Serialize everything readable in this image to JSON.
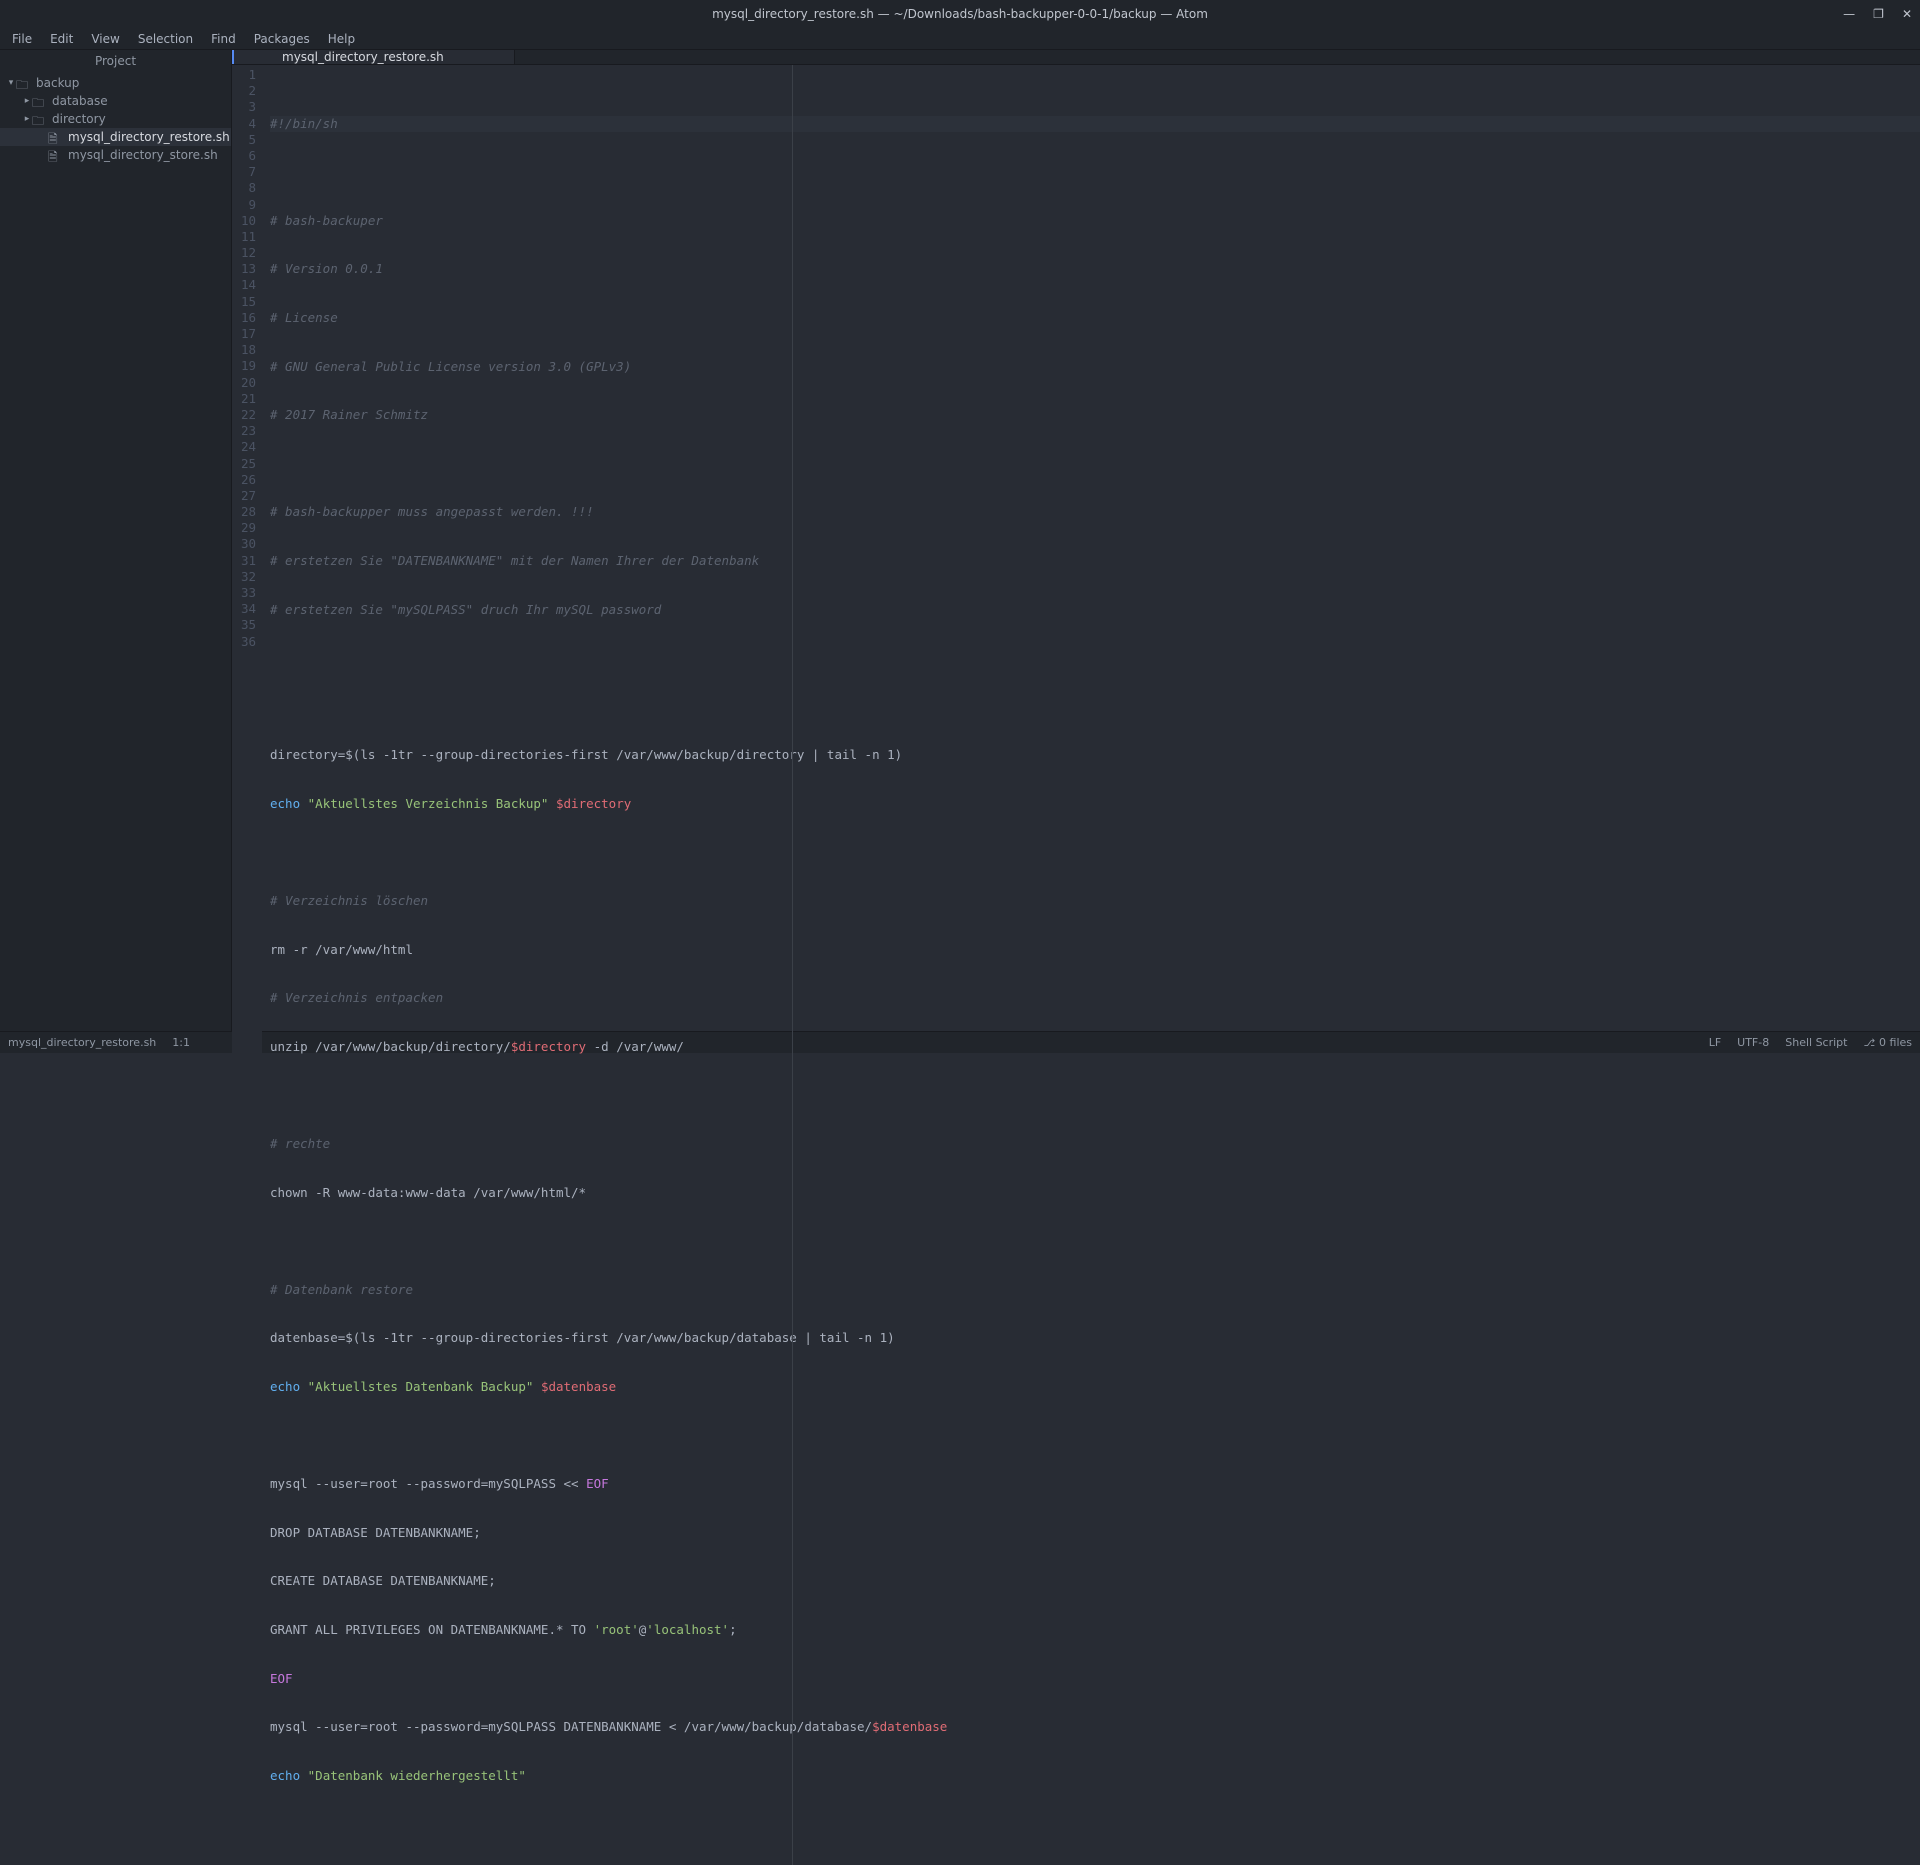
{
  "window": {
    "title": "mysql_directory_restore.sh — ~/Downloads/bash-backupper-0-0-1/backup — Atom"
  },
  "window_controls": {
    "minimize": "—",
    "maximize": "❐",
    "close": "✕"
  },
  "menu": {
    "file": "File",
    "edit": "Edit",
    "view": "View",
    "selection": "Selection",
    "find": "Find",
    "packages": "Packages",
    "help": "Help"
  },
  "sidebar": {
    "title": "Project",
    "tree": {
      "root": "backup",
      "folder_database": "database",
      "folder_directory": "directory",
      "file_restore": "mysql_directory_restore.sh",
      "file_store": "mysql_directory_store.sh"
    }
  },
  "tabs": {
    "t0": "mysql_directory_restore.sh"
  },
  "code": {
    "l1": "#!/bin/sh",
    "l2": "",
    "l3": "# bash-backuper",
    "l4": "# Version 0.0.1",
    "l5": "# License",
    "l6": "# GNU General Public License version 3.0 (GPLv3)",
    "l7": "# 2017 Rainer Schmitz",
    "l8": "",
    "l9": "# bash-backupper muss angepasst werden. !!!",
    "l10": "# erstetzen Sie \"DATENBANKNAME\" mit der Namen Ihrer der Datenbank",
    "l11": "# erstetzen Sie \"mySQLPASS\" druch Ihr mySQL password",
    "l12": "",
    "l13": "",
    "l14a": "directory=",
    "l14b": "$(",
    "l14c": "ls -1tr --group-directories-first /var/www/backup/directory ",
    "l14d": "|",
    "l14e": " tail -n 1)",
    "l15a": "echo",
    "l15b": " ",
    "l15c": "\"Aktuellstes Verzeichnis Backup\"",
    "l15d": " ",
    "l15e": "$directory",
    "l16": "",
    "l17": "# Verzeichnis löschen",
    "l18": "rm -r /var/www/html",
    "l19": "# Verzeichnis entpacken",
    "l20a": "unzip /var/www/backup/directory/",
    "l20b": "$directory",
    "l20c": " -d /var/www/",
    "l21": "",
    "l22": "# rechte",
    "l23": "chown -R www-data:www-data /var/www/html/*",
    "l24": "",
    "l25": "# Datenbank restore",
    "l26a": "datenbase=",
    "l26b": "$(",
    "l26c": "ls -1tr --group-directories-first /var/www/backup/database ",
    "l26d": "|",
    "l26e": " tail -n 1)",
    "l27a": "echo",
    "l27b": " ",
    "l27c": "\"Aktuellstes Datenbank Backup\"",
    "l27d": " ",
    "l27e": "$datenbase",
    "l28": "",
    "l29a": "mysql --user=root --password=mySQLPASS ",
    "l29b": "<<",
    "l29c": " ",
    "l29d": "EOF",
    "l30": "DROP DATABASE DATENBANKNAME;",
    "l31": "CREATE DATABASE DATENBANKNAME;",
    "l32a": "GRANT ALL PRIVILEGES ON DATENBANKNAME.* TO ",
    "l32b": "'root'",
    "l32c": "@",
    "l32d": "'localhost'",
    "l32e": ";",
    "l33": "EOF",
    "l34a": "mysql --user=root --password=mySQLPASS DATENBANKNAME ",
    "l34b": "<",
    "l34c": " /var/www/backup/database/",
    "l34d": "$datenbase",
    "l35a": "echo",
    "l35b": " ",
    "l35c": "\"Datenbank wiederhergestellt\"",
    "l36": ""
  },
  "linenumbers": {
    "n1": "1",
    "n2": "2",
    "n3": "3",
    "n4": "4",
    "n5": "5",
    "n6": "6",
    "n7": "7",
    "n8": "8",
    "n9": "9",
    "n10": "10",
    "n11": "11",
    "n12": "12",
    "n13": "13",
    "n14": "14",
    "n15": "15",
    "n16": "16",
    "n17": "17",
    "n18": "18",
    "n19": "19",
    "n20": "20",
    "n21": "21",
    "n22": "22",
    "n23": "23",
    "n24": "24",
    "n25": "25",
    "n26": "26",
    "n27": "27",
    "n28": "28",
    "n29": "29",
    "n30": "30",
    "n31": "31",
    "n32": "32",
    "n33": "33",
    "n34": "34",
    "n35": "35",
    "n36": "36"
  },
  "status": {
    "filename": "mysql_directory_restore.sh",
    "cursor": "1:1",
    "line_ending": "LF",
    "encoding": "UTF-8",
    "grammar": "Shell Script",
    "git": "0 files"
  }
}
